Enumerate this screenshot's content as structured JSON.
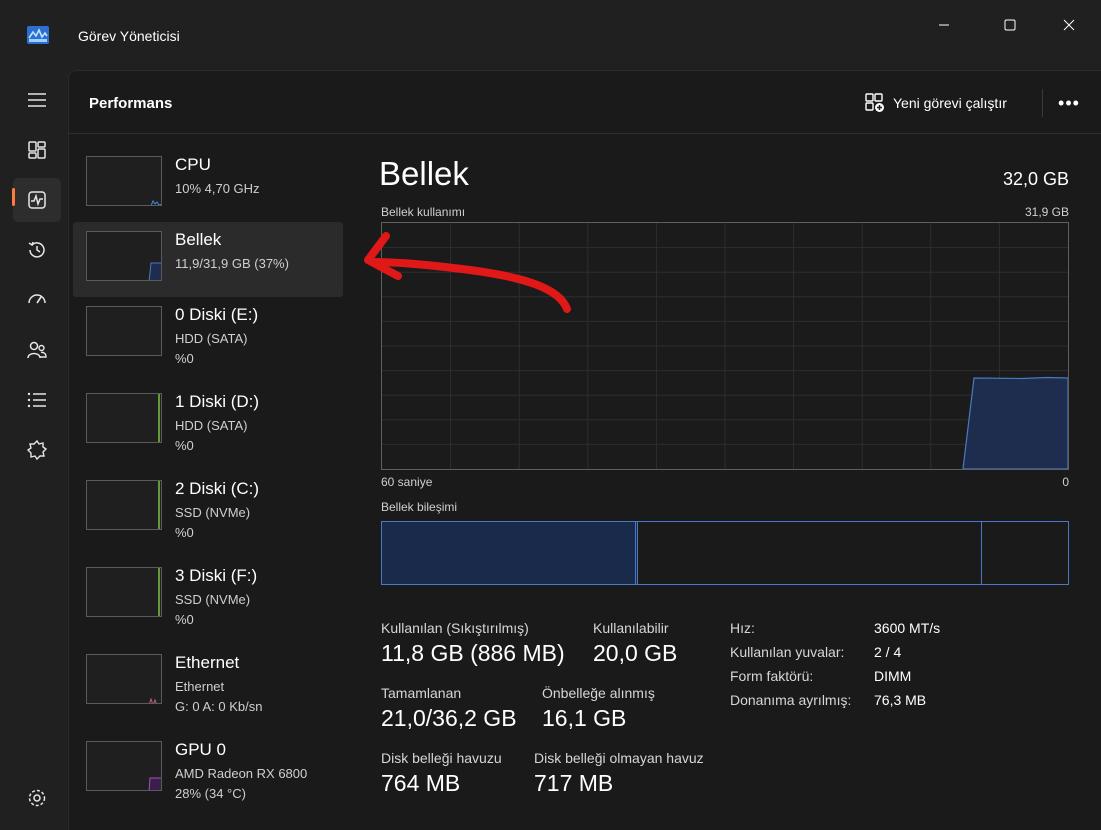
{
  "window": {
    "title": "Görev Yöneticisi",
    "controls": [
      "minimize",
      "maximize",
      "close"
    ]
  },
  "rail": {
    "items": [
      {
        "icon": "hamburger-menu-icon"
      },
      {
        "icon": "processes-icon"
      },
      {
        "icon": "performance-icon",
        "active": true
      },
      {
        "icon": "app-history-icon"
      },
      {
        "icon": "startup-apps-icon"
      },
      {
        "icon": "users-icon"
      },
      {
        "icon": "details-icon"
      },
      {
        "icon": "services-icon"
      },
      {
        "icon": "settings-icon"
      }
    ],
    "accent": "#ff7a3d"
  },
  "header": {
    "title": "Performans",
    "run_task_label": "Yeni görevi çalıştır",
    "more_label": "•••"
  },
  "devices": [
    {
      "name": "CPU",
      "line1": "10%  4,70 GHz",
      "line2": "",
      "color": "#3a8fd9",
      "usage": 0.1
    },
    {
      "name": "Bellek",
      "line1": "11,9/31,9 GB (37%)",
      "line2": "",
      "color": "#4a78c4",
      "usage": 0.37,
      "selected": true
    },
    {
      "name": "0 Diski (E:)",
      "line1": "HDD (SATA)",
      "line2": "%0",
      "color": "#7cc046",
      "usage": 0
    },
    {
      "name": "1 Diski (D:)",
      "line1": "HDD (SATA)",
      "line2": "%0",
      "color": "#7cc046",
      "usage": 0
    },
    {
      "name": "2 Diski (C:)",
      "line1": "SSD (NVMe)",
      "line2": "%0",
      "color": "#7cc046",
      "usage": 0
    },
    {
      "name": "3 Diski (F:)",
      "line1": "SSD (NVMe)",
      "line2": "%0",
      "color": "#7cc046",
      "usage": 0
    },
    {
      "name": "Ethernet",
      "line1": "Ethernet",
      "line2": "G: 0  A: 0 Kb/sn",
      "color": "#c05a8a",
      "usage": 0
    },
    {
      "name": "GPU 0",
      "line1": "AMD Radeon RX 6800",
      "line2": "28%  (34 °C)",
      "color": "#a24fc2",
      "usage": 0.28
    }
  ],
  "detail": {
    "title": "Bellek",
    "total": "32,0 GB",
    "usage_graph": {
      "label": "Bellek kullanımı",
      "max_label": "31,9 GB",
      "time_left": "60 saniye",
      "time_right": "0",
      "line_color": "#4a78c4",
      "fill_color": "#1e2d4d",
      "recent_usage_fraction": 0.37
    },
    "composition": {
      "label": "Bellek bileşimi",
      "segments": [
        {
          "name": "in-use",
          "fraction": 0.37,
          "fill": "#1a2a4a"
        },
        {
          "name": "modified",
          "fraction": 0.004,
          "fill": "#1a2a4a"
        },
        {
          "name": "standby",
          "fraction": 0.5,
          "fill": "#1a1a1a"
        },
        {
          "name": "free",
          "fraction": 0.126,
          "fill": "#1a1a1a"
        }
      ]
    },
    "stats": {
      "in_use_label": "Kullanılan (Sıkıştırılmış)",
      "in_use_value": "11,8 GB (886 MB)",
      "available_label": "Kullanılabilir",
      "available_value": "20,0 GB",
      "committed_label": "Tamamlanan",
      "committed_value": "21,0/36,2 GB",
      "cached_label": "Önbelleğe alınmış",
      "cached_value": "16,1 GB",
      "paged_label": "Disk belleği havuzu",
      "paged_value": "764 MB",
      "nonpaged_label": "Disk belleği olmayan havuz",
      "nonpaged_value": "717 MB"
    },
    "specs": {
      "speed_label": "Hız:",
      "speed_value": "3600 MT/s",
      "slots_label": "Kullanılan yuvalar:",
      "slots_value": "2 / 4",
      "form_label": "Form faktörü:",
      "form_value": "DIMM",
      "reserved_label": "Donanıma ayrılmış:",
      "reserved_value": "76,3 MB"
    }
  },
  "annotation": {
    "color": "#e01818"
  }
}
